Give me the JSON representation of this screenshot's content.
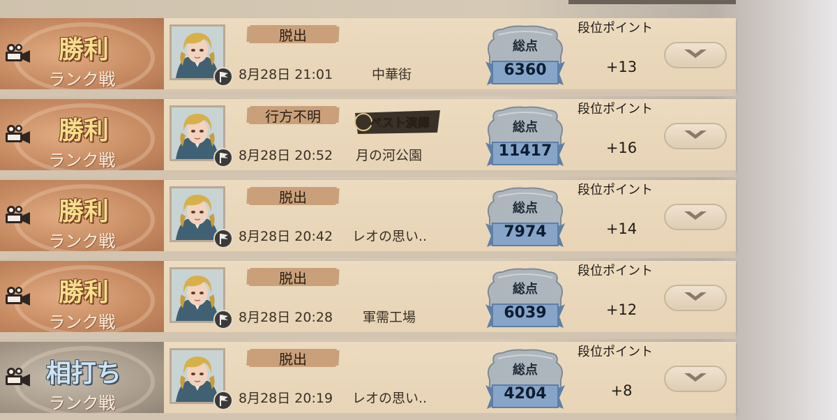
{
  "matches": [
    {
      "result": "勝利",
      "mode": "ランク戦",
      "status": "脱出",
      "datetime": "8月28日 21:01",
      "map": "中華街",
      "score_label": "総点",
      "score": "6360",
      "rank_label": "段位ポイント",
      "rank_delta": "+13",
      "result_type": "win",
      "best_badge": false
    },
    {
      "result": "勝利",
      "mode": "ランク戦",
      "status": "行方不明",
      "datetime": "8月28日 20:52",
      "map": "月の河公園",
      "score_label": "総点",
      "score": "11417",
      "rank_label": "段位ポイント",
      "rank_delta": "+16",
      "result_type": "win",
      "best_badge": true,
      "best_badge_text": "ベスト演繹"
    },
    {
      "result": "勝利",
      "mode": "ランク戦",
      "status": "脱出",
      "datetime": "8月28日 20:42",
      "map": "レオの思い..",
      "score_label": "総点",
      "score": "7974",
      "rank_label": "段位ポイント",
      "rank_delta": "+14",
      "result_type": "win",
      "best_badge": false
    },
    {
      "result": "勝利",
      "mode": "ランク戦",
      "status": "脱出",
      "datetime": "8月28日 20:28",
      "map": "軍需工場",
      "score_label": "総点",
      "score": "6039",
      "rank_label": "段位ポイント",
      "rank_delta": "+12",
      "result_type": "win",
      "best_badge": false
    },
    {
      "result": "相打ち",
      "mode": "ランク戦",
      "status": "脱出",
      "datetime": "8月28日 20:19",
      "map": "レオの思い..",
      "score_label": "総点",
      "score": "4204",
      "rank_label": "段位ポイント",
      "rank_delta": "+8",
      "result_type": "tie",
      "best_badge": false
    }
  ],
  "colors": {
    "win_text": "#f7df8c",
    "tie_text": "#cfe4f2",
    "status_tag": "#c9a079",
    "plaque": "#7d9cbf"
  },
  "icons": {
    "replay": "film-camera-icon",
    "flag": "white-flag-icon",
    "expand": "chevron-down-icon"
  }
}
